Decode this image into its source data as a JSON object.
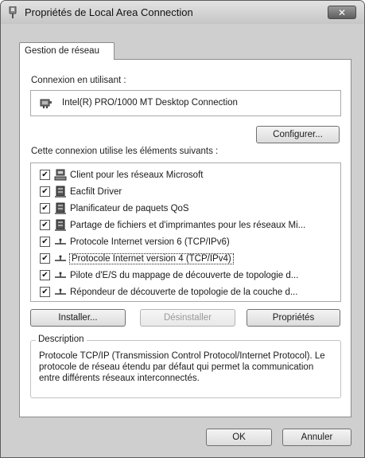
{
  "window": {
    "title": "Propriétés de Local Area Connection",
    "close_label": "✕"
  },
  "tabs": [
    {
      "label": "Gestion de réseau"
    }
  ],
  "connection": {
    "label": "Connexion en utilisant :",
    "adapter": "Intel(R) PRO/1000 MT Desktop Connection",
    "configure_label": "Configurer..."
  },
  "items": {
    "label": "Cette connexion utilise les éléments suivants :",
    "list": [
      {
        "label": "Client pour les réseaux Microsoft",
        "checked": true,
        "icon": "network-client-icon"
      },
      {
        "label": "Eacfilt Driver",
        "checked": true,
        "icon": "network-service-icon"
      },
      {
        "label": "Planificateur de paquets QoS",
        "checked": true,
        "icon": "network-service-icon"
      },
      {
        "label": "Partage de fichiers et d'imprimantes pour les réseaux Mi...",
        "checked": true,
        "icon": "network-service-icon"
      },
      {
        "label": "Protocole Internet version 6 (TCP/IPv6)",
        "checked": true,
        "icon": "protocol-icon"
      },
      {
        "label": "Protocole Internet version 4 (TCP/IPv4)",
        "checked": true,
        "icon": "protocol-icon",
        "focused": true
      },
      {
        "label": "Pilote d'E/S du mappage de découverte de topologie d...",
        "checked": true,
        "icon": "protocol-icon"
      },
      {
        "label": "Répondeur de découverte de topologie de la couche d...",
        "checked": true,
        "icon": "protocol-icon"
      }
    ]
  },
  "actions": {
    "install": "Installer...",
    "uninstall": "Désinstaller",
    "properties": "Propriétés"
  },
  "description": {
    "legend": "Description",
    "text": "Protocole TCP/IP (Transmission Control Protocol/Internet Protocol). Le protocole de réseau étendu par défaut qui permet la communication entre différents réseaux interconnectés."
  },
  "footer": {
    "ok": "OK",
    "cancel": "Annuler"
  },
  "colors": {
    "window_bg": "#cfcfcf",
    "panel_bg": "#ffffff",
    "border": "#8a8a8a"
  }
}
